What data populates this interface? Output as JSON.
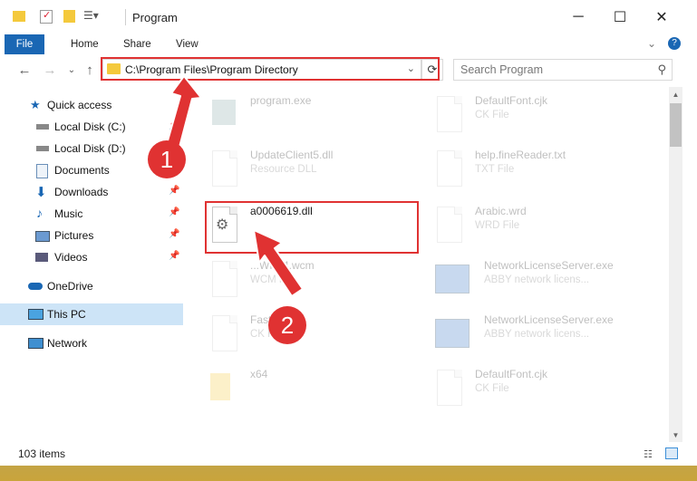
{
  "titlebar": {
    "title": "Program"
  },
  "ribbon": {
    "tabs": [
      "File",
      "Home",
      "Share",
      "View"
    ]
  },
  "address": {
    "path": "C:\\Program Files\\Program Directory",
    "search_placeholder": "Search Program"
  },
  "sidebar": {
    "items": [
      {
        "label": "Quick access",
        "icon": "star-icon"
      },
      {
        "label": "Local Disk (C:)",
        "icon": "drive-icon"
      },
      {
        "label": "Local Disk (D:)",
        "icon": "drive-icon"
      },
      {
        "label": "Documents",
        "icon": "documents-icon"
      },
      {
        "label": "Downloads",
        "icon": "downloads-icon"
      },
      {
        "label": "Music",
        "icon": "music-icon"
      },
      {
        "label": "Pictures",
        "icon": "pictures-icon"
      },
      {
        "label": "Videos",
        "icon": "videos-icon"
      },
      {
        "label": "OneDrive",
        "icon": "cloud-icon"
      },
      {
        "label": "This PC",
        "icon": "pc-icon"
      },
      {
        "label": "Network",
        "icon": "network-icon"
      }
    ]
  },
  "files": {
    "left": [
      {
        "name": "program.exe",
        "sub": ""
      },
      {
        "name": "UpdateClient5.dll",
        "sub": "Resource DLL"
      },
      {
        "name": "a0006619.dll",
        "sub": ""
      },
      {
        "name": "...WP14.wcm",
        "sub": "WCM File"
      },
      {
        "name": "Fast...",
        "sub": "CK File"
      },
      {
        "name": "x64",
        "sub": ""
      }
    ],
    "right": [
      {
        "name": "DefaultFont.cjk",
        "sub": "CK File"
      },
      {
        "name": "help.fineReader.txt",
        "sub": "TXT File"
      },
      {
        "name": "Arabic.wrd",
        "sub": "WRD File"
      },
      {
        "name": "NetworkLicenseServer.exe",
        "sub": "ABBY network licens..."
      },
      {
        "name": "NetworkLicenseServer.exe",
        "sub": "ABBY network licens..."
      },
      {
        "name": "DefaultFont.cjk",
        "sub": "CK File"
      }
    ]
  },
  "annotations": {
    "step1": "1",
    "step2": "2"
  },
  "status": {
    "item_count": "103 items"
  },
  "colors": {
    "file_tab": "#1a67b4",
    "highlight": "#e03232",
    "selected": "#cde4f7"
  }
}
